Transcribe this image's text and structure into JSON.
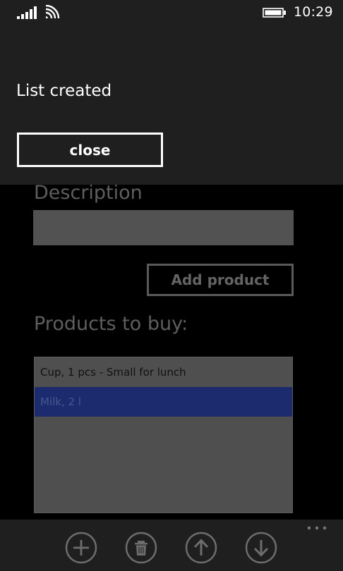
{
  "status_bar": {
    "time": "10:29",
    "signal_icon": "signal-strength-icon",
    "wifi_icon": "wifi-icon",
    "battery_icon": "battery-icon"
  },
  "popup": {
    "message": "List created",
    "close_label": "close"
  },
  "form": {
    "description_label": "Description",
    "description_value": "",
    "add_product_label": "Add product",
    "products_label": "Products to buy:"
  },
  "products": [
    {
      "text": "Cup, 1 pcs - Small for lunch",
      "selected": false
    },
    {
      "text": "Milk, 2 l",
      "selected": true
    }
  ],
  "app_bar": {
    "buttons": [
      "add-icon",
      "delete-icon",
      "arrow-up-icon",
      "arrow-down-icon"
    ],
    "more_icon": "more-dots-icon"
  },
  "colors": {
    "popup_background": "#1f1f1f",
    "selection": "#1c2b6e",
    "page_background": "#000000"
  }
}
